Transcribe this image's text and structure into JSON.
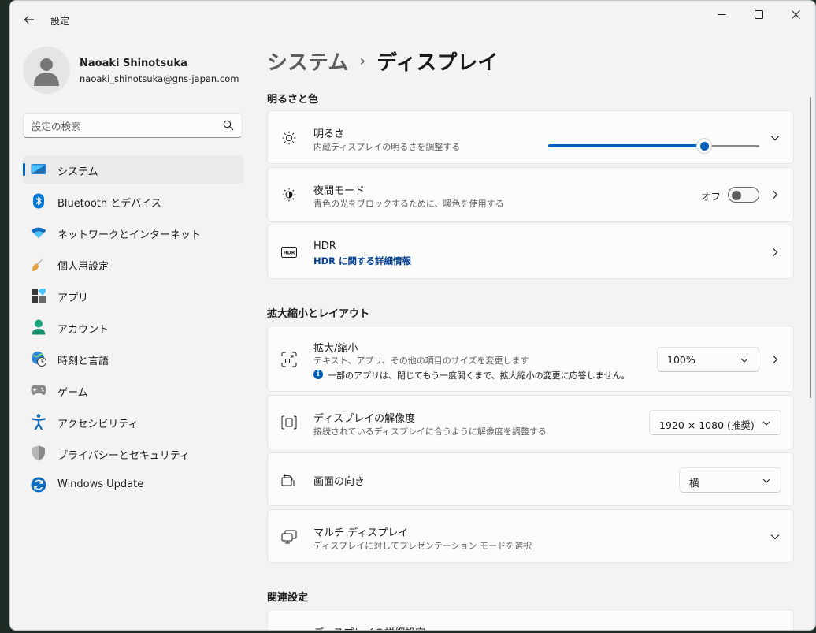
{
  "window": {
    "title": "設定"
  },
  "user": {
    "name": "Naoaki Shinotsuka",
    "email": "naoaki_shinotsuka@gns-japan.com"
  },
  "search": {
    "placeholder": "設定の検索"
  },
  "nav": {
    "items": [
      {
        "label": "システム",
        "icon": "system-icon",
        "active": true
      },
      {
        "label": "Bluetooth とデバイス",
        "icon": "bluetooth-icon"
      },
      {
        "label": "ネットワークとインターネット",
        "icon": "network-icon"
      },
      {
        "label": "個人用設定",
        "icon": "brush-icon"
      },
      {
        "label": "アプリ",
        "icon": "apps-icon"
      },
      {
        "label": "アカウント",
        "icon": "account-icon"
      },
      {
        "label": "時刻と言語",
        "icon": "time-language-icon"
      },
      {
        "label": "ゲーム",
        "icon": "gamepad-icon"
      },
      {
        "label": "アクセシビリティ",
        "icon": "accessibility-icon"
      },
      {
        "label": "プライバシーとセキュリティ",
        "icon": "shield-icon"
      },
      {
        "label": "Windows Update",
        "icon": "windows-update-icon"
      }
    ]
  },
  "breadcrumb": {
    "parent": "システム",
    "separator": "›",
    "current": "ディスプレイ"
  },
  "sections": {
    "brightness_color": "明るさと色",
    "scale_layout": "拡大縮小とレイアウト",
    "related": "関連設定"
  },
  "brightness": {
    "title": "明るさ",
    "subtitle": "内蔵ディスプレイの明るさを調整する",
    "level_percent": 74
  },
  "night_light": {
    "title": "夜間モード",
    "subtitle": "青色の光をブロックするために、暖色を使用する",
    "state_label": "オフ"
  },
  "hdr": {
    "title": "HDR",
    "link": "HDR に関する詳細情報"
  },
  "scale": {
    "title": "拡大/縮小",
    "subtitle": "テキスト、アプリ、その他の項目のサイズを変更します",
    "info": "一部のアプリは、閉じてもう一度開くまで、拡大縮小の変更に応答しません。",
    "value": "100%"
  },
  "resolution": {
    "title": "ディスプレイの解像度",
    "subtitle": "接続されているディスプレイに合うように解像度を調整する",
    "value": "1920 × 1080 (推奨)"
  },
  "orientation": {
    "title": "画面の向き",
    "value": "横"
  },
  "multi_display": {
    "title": "マルチ ディスプレイ",
    "subtitle": "ディスプレイに対してプレゼンテーション モードを選択"
  },
  "advanced_display": {
    "title": "ディスプレイの詳細設定"
  },
  "colors": {
    "accent": "#005fb8",
    "link": "#003e92"
  }
}
